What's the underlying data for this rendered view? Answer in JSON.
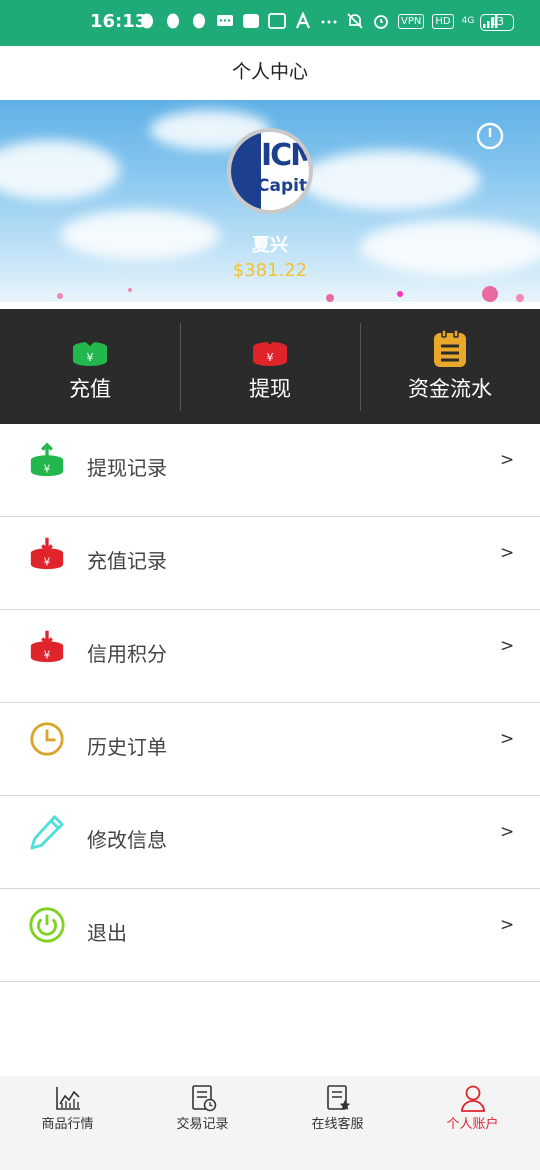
{
  "status_bar": {
    "time": "16:13",
    "vpn": "VPN",
    "hd": "HD",
    "network": "4G",
    "battery": "13"
  },
  "header": {
    "title": "个人中心"
  },
  "profile": {
    "name": "夏兴",
    "balance": "$381.22",
    "avatar_text_1": "ICM",
    "avatar_text_2": "Capita"
  },
  "actions": [
    {
      "label": "充值",
      "icon": "deposit-icon",
      "color": "#22b84d"
    },
    {
      "label": "提现",
      "icon": "withdraw-icon",
      "color": "#e0242c"
    },
    {
      "label": "资金流水",
      "icon": "clipboard-icon",
      "color": "#e8a82b"
    }
  ],
  "menu": [
    {
      "label": "提现记录",
      "icon": "withdraw-record-icon",
      "arrow": ">"
    },
    {
      "label": "充值记录",
      "icon": "deposit-record-icon",
      "arrow": ">"
    },
    {
      "label": "信用积分",
      "icon": "credit-score-icon",
      "arrow": ">"
    },
    {
      "label": "历史订单",
      "icon": "clock-icon",
      "arrow": ">"
    },
    {
      "label": "修改信息",
      "icon": "pencil-icon",
      "arrow": ">"
    },
    {
      "label": "退出",
      "icon": "power-icon",
      "arrow": ">"
    }
  ],
  "bottom_nav": [
    {
      "label": "商品行情",
      "icon": "chart-icon",
      "active": false
    },
    {
      "label": "交易记录",
      "icon": "document-clock-icon",
      "active": false
    },
    {
      "label": "在线客服",
      "icon": "document-star-icon",
      "active": false
    },
    {
      "label": "个人账户",
      "icon": "user-icon",
      "active": true
    }
  ],
  "colors": {
    "status_bar": "#1fab78",
    "action_bar": "#2b2b2b",
    "balance": "#f2c230",
    "active_nav": "#e0242c",
    "green": "#22b84d",
    "red": "#e0242c",
    "gold": "#e8a82b",
    "clock": "#d9a52c",
    "pencil": "#4de0d8",
    "power": "#7ed321"
  }
}
